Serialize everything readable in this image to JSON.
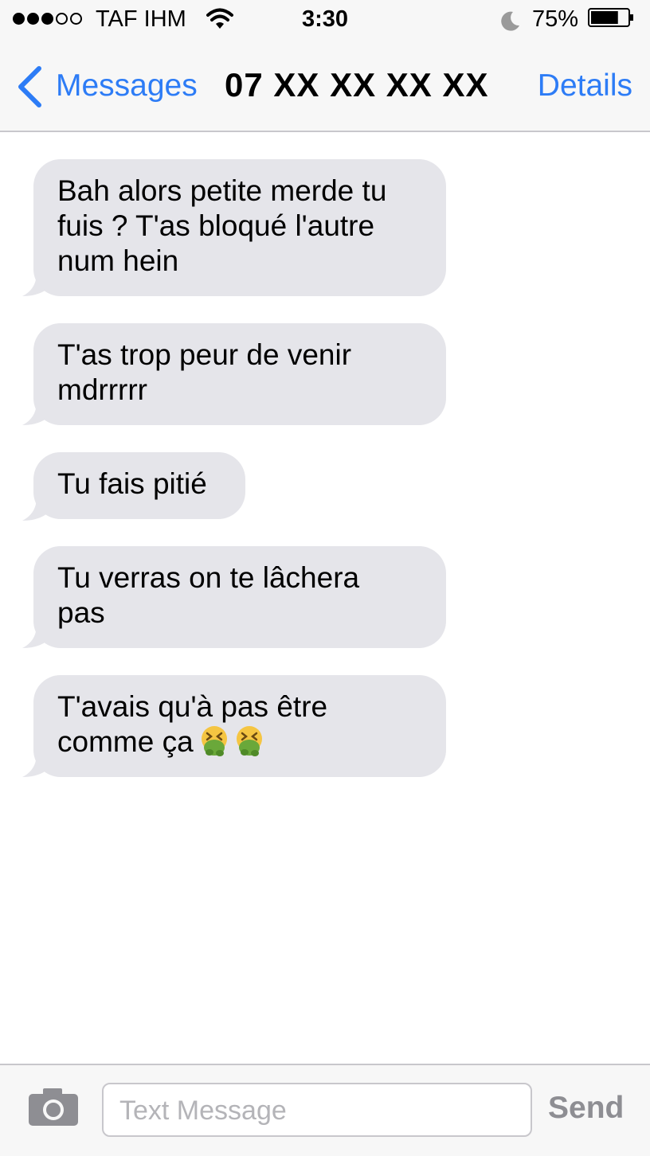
{
  "status_bar": {
    "signal_bars_filled": 3,
    "signal_bars_total": 5,
    "carrier": "TAF IHM",
    "wifi_icon": "wifi-icon",
    "time": "3:30",
    "do_not_disturb_icon": "moon-icon",
    "battery_percent": "75%",
    "battery_level": 0.75
  },
  "nav": {
    "back_icon": "chevron-left-icon",
    "back_label": "Messages",
    "title": "07 XX XX XX XX",
    "details_label": "Details",
    "accent_color": "#2d7cf6"
  },
  "messages": [
    {
      "text": "Bah alors petite merde tu\nfuis ? T'as bloqué l'autre\nnum hein"
    },
    {
      "text": "T'as trop peur de venir\nmdrrrrr"
    },
    {
      "text": "Tu fais pitié"
    },
    {
      "text": "Tu verras on te lâchera\npas"
    },
    {
      "text": "T'avais qu'à pas être\ncomme ça",
      "emoji": [
        "vomiting-face-icon",
        "vomiting-face-icon"
      ]
    }
  ],
  "bubble_color": "#e5e5ea",
  "input_bar": {
    "camera_icon": "camera-icon",
    "placeholder": "Text Message",
    "send_label": "Send"
  }
}
